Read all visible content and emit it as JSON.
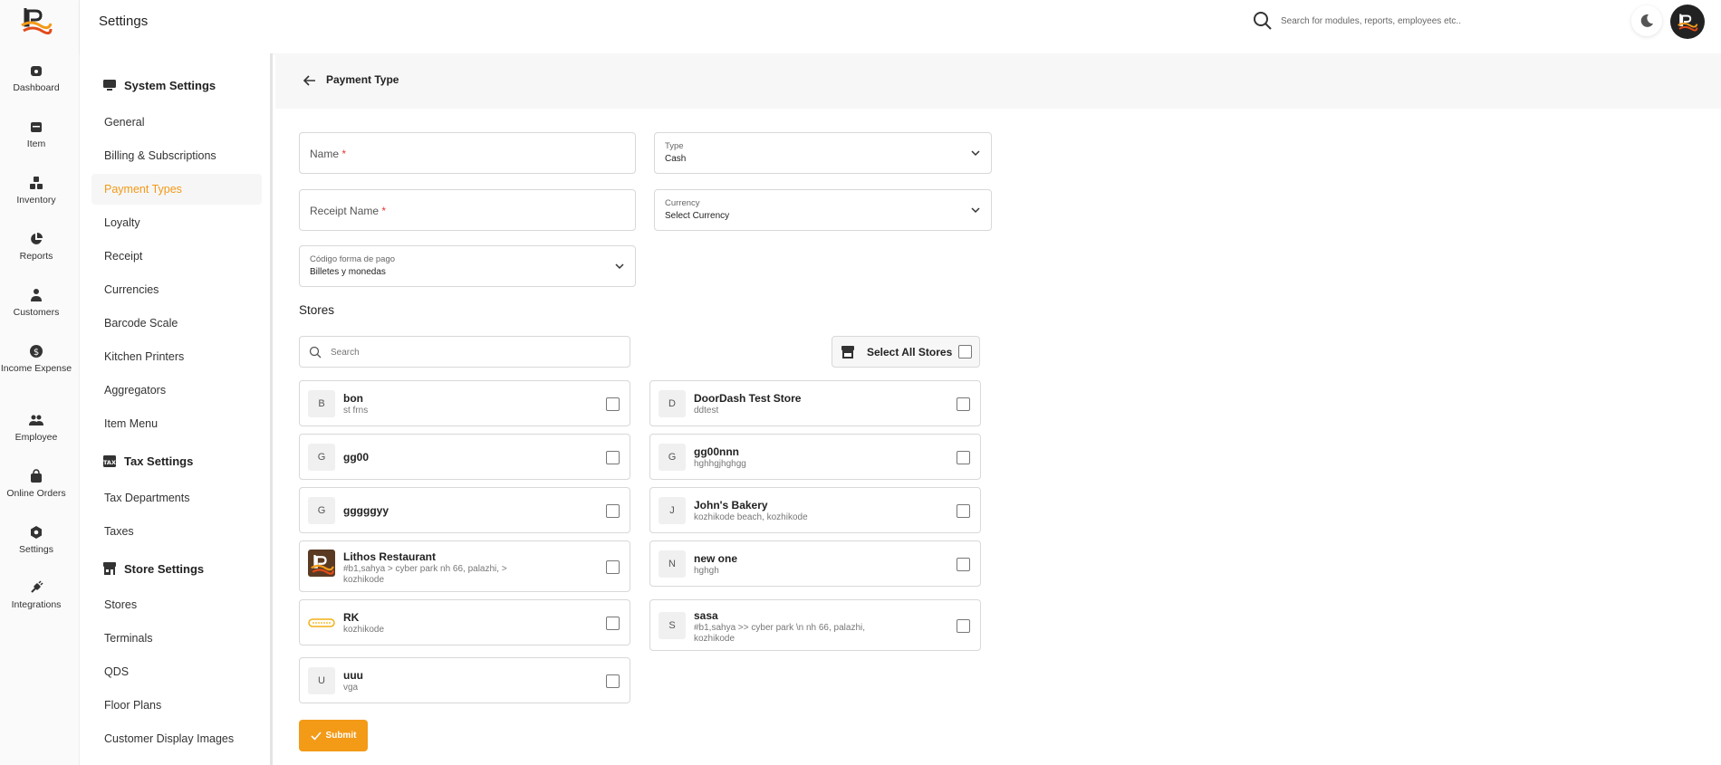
{
  "rail": {
    "items": [
      {
        "label": "Dashboard",
        "icon": "dashboard-icon"
      },
      {
        "label": "Item",
        "icon": "item-icon"
      },
      {
        "label": "Inventory",
        "icon": "inventory-icon"
      },
      {
        "label": "Reports",
        "icon": "pie-chart-icon"
      },
      {
        "label": "Customers",
        "icon": "customers-icon"
      },
      {
        "label": "Income Expense",
        "icon": "dollar-icon"
      },
      {
        "label": "Employee",
        "icon": "employee-icon"
      },
      {
        "label": "Online Orders",
        "icon": "bag-icon"
      },
      {
        "label": "Settings",
        "icon": "gear-icon"
      },
      {
        "label": "Integrations",
        "icon": "plug-icon"
      }
    ]
  },
  "topbar": {
    "title": "Settings",
    "search_placeholder": "Search for modules, reports, employees etc.."
  },
  "sidebar": {
    "sections": [
      {
        "title": "System Settings",
        "icon": "monitor-icon"
      },
      {
        "title": "Tax Settings",
        "icon": "tax-icon"
      },
      {
        "title": "Store Settings",
        "icon": "store-icon"
      }
    ],
    "system_items": [
      "General",
      "Billing & Subscriptions",
      "Payment Types",
      "Loyalty",
      "Receipt",
      "Currencies",
      "Barcode Scale",
      "Kitchen Printers",
      "Aggregators",
      "Item Menu"
    ],
    "tax_items": [
      "Tax Departments",
      "Taxes"
    ],
    "store_items": [
      "Stores",
      "Terminals",
      "QDS",
      "Floor Plans",
      "Customer Display Images"
    ],
    "active": "Payment Types"
  },
  "page": {
    "title": "Payment Type",
    "name_label": "Name",
    "receipt_name_label": "Receipt Name",
    "required_mark": "*",
    "type": {
      "caption": "Type",
      "value": "Cash"
    },
    "currency": {
      "caption": "Currency",
      "value": "Select Currency"
    },
    "codigo": {
      "caption": "Código forma de pago",
      "value": "Billetes y monedas"
    },
    "stores_title": "Stores",
    "store_search_placeholder": "Search",
    "select_all_label": "Select All Stores",
    "submit_label": "Submit"
  },
  "stores": [
    {
      "name": "bon",
      "sub": "st frns",
      "initial": "B"
    },
    {
      "name": "DoorDash Test Store",
      "sub": "ddtest",
      "initial": "D"
    },
    {
      "name": "gg00",
      "sub": "",
      "initial": "G"
    },
    {
      "name": "gg00nnn",
      "sub": "hghhgjhghgg",
      "initial": "G"
    },
    {
      "name": "gggggyy",
      "sub": "",
      "initial": "G"
    },
    {
      "name": "John's Bakery",
      "sub": "kozhikode beach, kozhikode",
      "initial": "J"
    },
    {
      "name": "Lithos Restaurant",
      "sub": "#b1,sahya > cyber park nh 66, palazhi, > kozhikode",
      "initial": ""
    },
    {
      "name": "new one",
      "sub": "hghgh",
      "initial": "N"
    },
    {
      "name": "RK",
      "sub": "kozhikode",
      "initial": ""
    },
    {
      "name": "sasa",
      "sub": "#b1,sahya >> cyber park \\n nh 66, palazhi, kozhikode",
      "initial": "S"
    },
    {
      "name": "uuu",
      "sub": "vga",
      "initial": "U"
    }
  ],
  "colors": {
    "accent": "#f39a17",
    "required": "#e53935"
  }
}
